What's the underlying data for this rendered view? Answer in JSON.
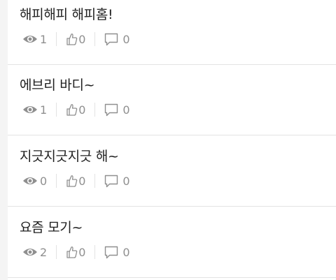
{
  "posts": [
    {
      "title": "해피해피 해피홈!",
      "views": "1",
      "likes": "0",
      "comments": "0"
    },
    {
      "title": "에브리 바디~",
      "views": "1",
      "likes": "0",
      "comments": "0"
    },
    {
      "title": "지긋지긋지긋 해~",
      "views": "0",
      "likes": "0",
      "comments": "0"
    },
    {
      "title": "요즘 모기~",
      "views": "2",
      "likes": "0",
      "comments": "0"
    }
  ],
  "icons": {
    "views": "eye-icon",
    "likes": "thumbs-up-icon",
    "comments": "speech-bubble-icon"
  },
  "colors": {
    "title": "#1f1f1f",
    "meta": "#8f8f8f",
    "divider": "#e3e3e3"
  }
}
